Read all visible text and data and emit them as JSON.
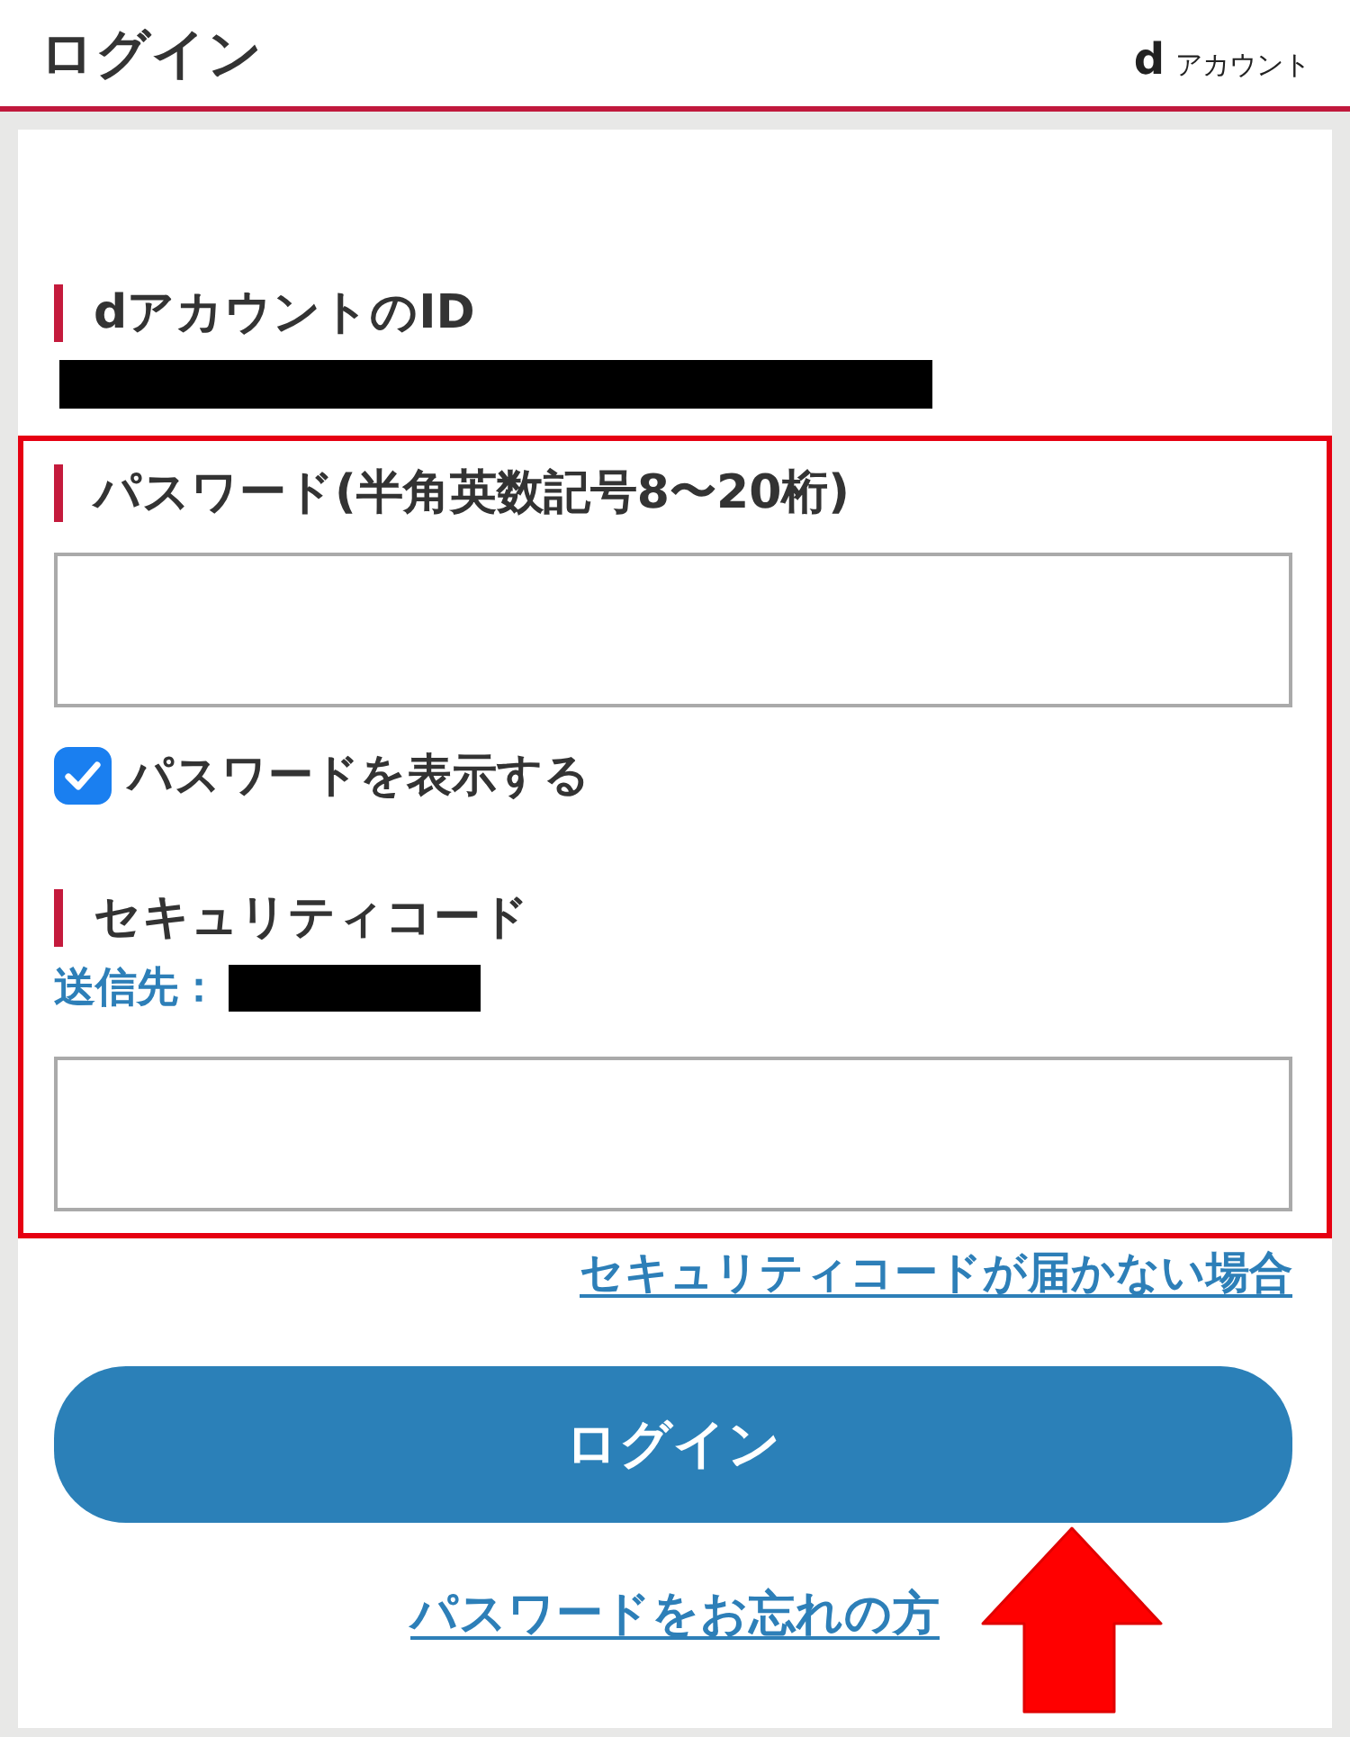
{
  "header": {
    "title": "ログイン",
    "logo": {
      "mark": "d",
      "text": "アカウント"
    }
  },
  "account_id": {
    "label": "dアカウントのID",
    "redacted": true
  },
  "form": {
    "highlighted": true,
    "password": {
      "label": "パスワード(半角英数記号8〜20桁)",
      "show_password": {
        "label": "パスワードを表示する",
        "checked": true
      }
    },
    "security_code": {
      "label": "セキュリティコード",
      "destination_label": "送信先：",
      "destination_redacted": true
    }
  },
  "code_help_link": "セキュリティコードが届かない場合",
  "login_button": "ログイン",
  "forgot_link": "パスワードをお忘れの方",
  "callout": {
    "kind": "arrow"
  }
}
